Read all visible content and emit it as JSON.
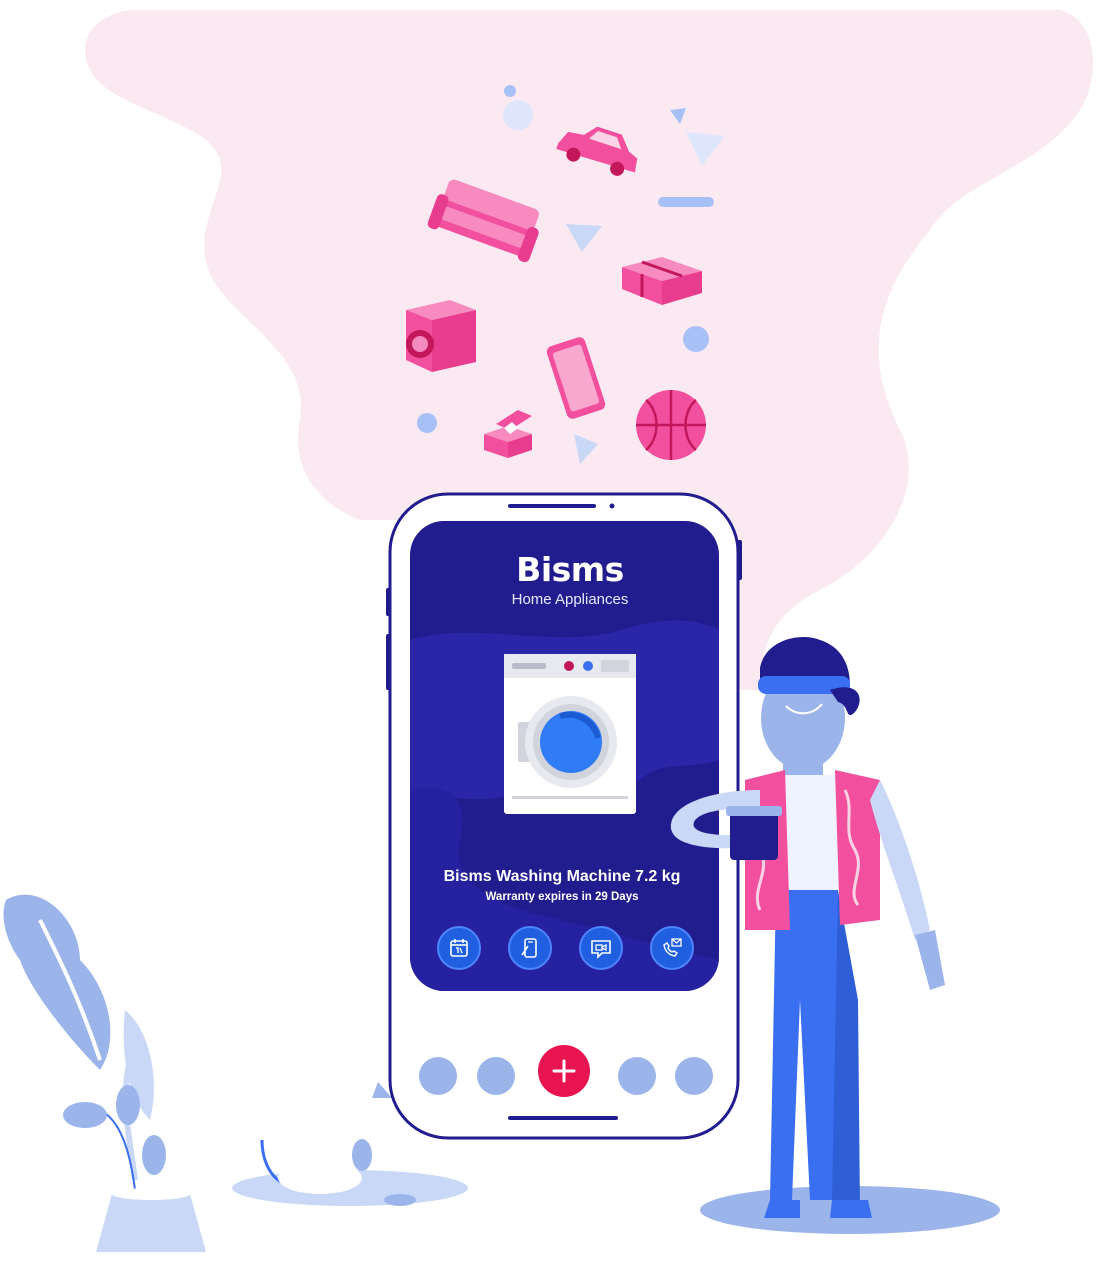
{
  "app": {
    "brand": "Bisms",
    "subtitle": "Home Appliances"
  },
  "product": {
    "name": "Bisms Washing Machine 7.2 kg",
    "warranty": "Warranty expires in 29 Days"
  },
  "actions": [
    {
      "icon": "calendar-icon"
    },
    {
      "icon": "phone-document-icon"
    },
    {
      "icon": "video-chat-icon"
    },
    {
      "icon": "phone-mail-icon"
    }
  ],
  "bottom_nav": {
    "items": [
      "nav-dot",
      "nav-dot",
      "add-icon",
      "nav-dot",
      "nav-dot"
    ]
  },
  "colors": {
    "screen": "#221d8e",
    "accent_pink": "#f2509f",
    "add_button": "#e8144f",
    "nav_dot": "#9bb5ea",
    "action_button": "#1f5fe0",
    "cloud": "#fbe9f1"
  }
}
